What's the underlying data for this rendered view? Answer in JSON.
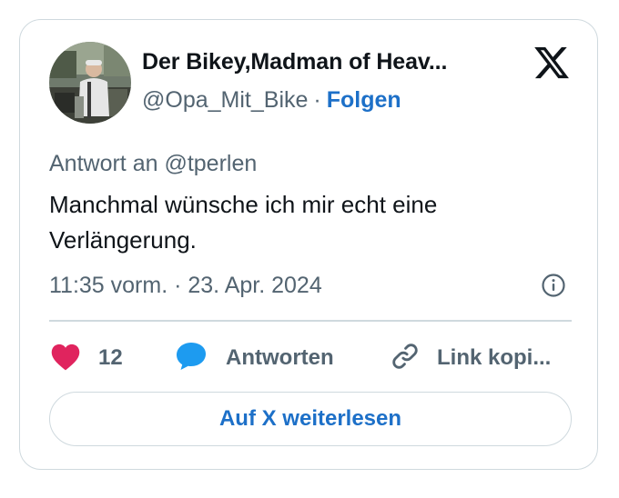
{
  "author": {
    "name": "Der Bikey,Madman of Heav...",
    "handle": "@Opa_Mit_Bike",
    "separator": "·",
    "follow_label": "Folgen"
  },
  "tweet": {
    "reply_to": "Antwort an @tperlen",
    "text": "Manchmal wünsche ich mir echt eine Verlängerung.",
    "timestamp": "11:35 vorm. · 23. Apr. 2024"
  },
  "actions": {
    "like_count": "12",
    "reply_label": "Antworten",
    "copy_link_label": "Link kopi..."
  },
  "read_more_label": "Auf X weiterlesen",
  "colors": {
    "like": "#e0245e",
    "reply": "#1d9bf0",
    "link": "#1d70c8",
    "muted": "#536471",
    "border": "#cfd9de"
  },
  "icons": [
    "x-logo-icon",
    "info-icon",
    "heart-icon",
    "speech-bubble-icon",
    "link-icon"
  ]
}
